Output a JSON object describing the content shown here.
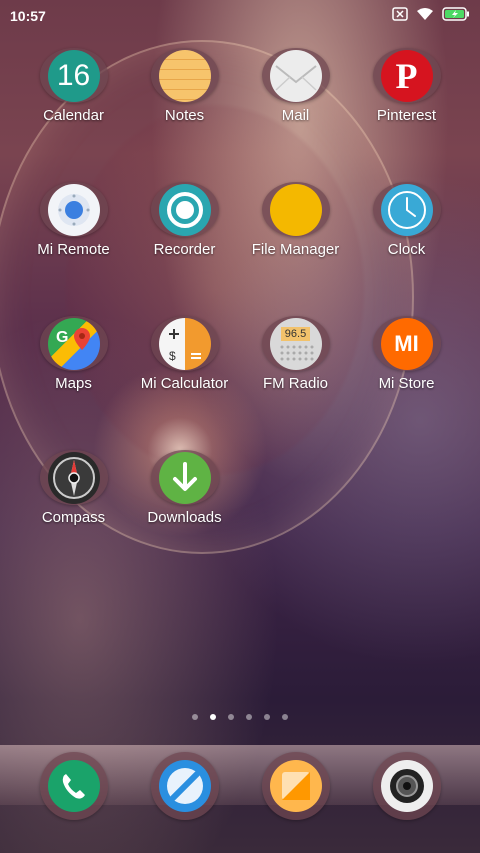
{
  "status_bar": {
    "time": "10:57"
  },
  "apps": [
    {
      "name": "calendar",
      "label": "Calendar",
      "icon": "calendar-icon",
      "value": "16"
    },
    {
      "name": "notes",
      "label": "Notes",
      "icon": "notes-icon"
    },
    {
      "name": "mail",
      "label": "Mail",
      "icon": "mail-icon"
    },
    {
      "name": "pinterest",
      "label": "Pinterest",
      "icon": "pinterest-icon"
    },
    {
      "name": "mi-remote",
      "label": "Mi Remote",
      "icon": "remote-icon"
    },
    {
      "name": "recorder",
      "label": "Recorder",
      "icon": "recorder-icon"
    },
    {
      "name": "file-manager",
      "label": "File Manager",
      "icon": "folder-icon"
    },
    {
      "name": "clock",
      "label": "Clock",
      "icon": "clock-icon"
    },
    {
      "name": "maps",
      "label": "Maps",
      "icon": "maps-icon"
    },
    {
      "name": "mi-calculator",
      "label": "Mi Calculator",
      "icon": "calculator-icon"
    },
    {
      "name": "fm-radio",
      "label": "FM Radio",
      "icon": "radio-icon",
      "value": "96.5"
    },
    {
      "name": "mi-store",
      "label": "Mi Store",
      "icon": "mi-store-icon",
      "value": "MI"
    },
    {
      "name": "compass",
      "label": "Compass",
      "icon": "compass-icon"
    },
    {
      "name": "downloads",
      "label": "Downloads",
      "icon": "download-icon"
    }
  ],
  "pager": {
    "count": 6,
    "active": 1
  },
  "dock": [
    {
      "name": "phone",
      "icon": "phone-icon"
    },
    {
      "name": "browser",
      "icon": "browser-icon"
    },
    {
      "name": "gallery",
      "icon": "gallery-icon"
    },
    {
      "name": "camera",
      "icon": "camera-icon"
    }
  ],
  "colors": {
    "calendar": "#1f9a8a",
    "notes": "#f5b454",
    "mail": "#e8e8e8",
    "pinterest": "#d6141f",
    "remote": "#f2f4f8",
    "recorder": "#2aa6b0",
    "file_manager": "#f4b800",
    "clock": "#39a9d6",
    "maps": "#34a853",
    "calculator": "#f29a2e",
    "radio": "#d9d9d9",
    "mi_store": "#ff6a00",
    "downloads": "#5fb344",
    "phone": "#1aa36a",
    "browser": "#2a8fe0",
    "gallery": "#ffb74d"
  }
}
